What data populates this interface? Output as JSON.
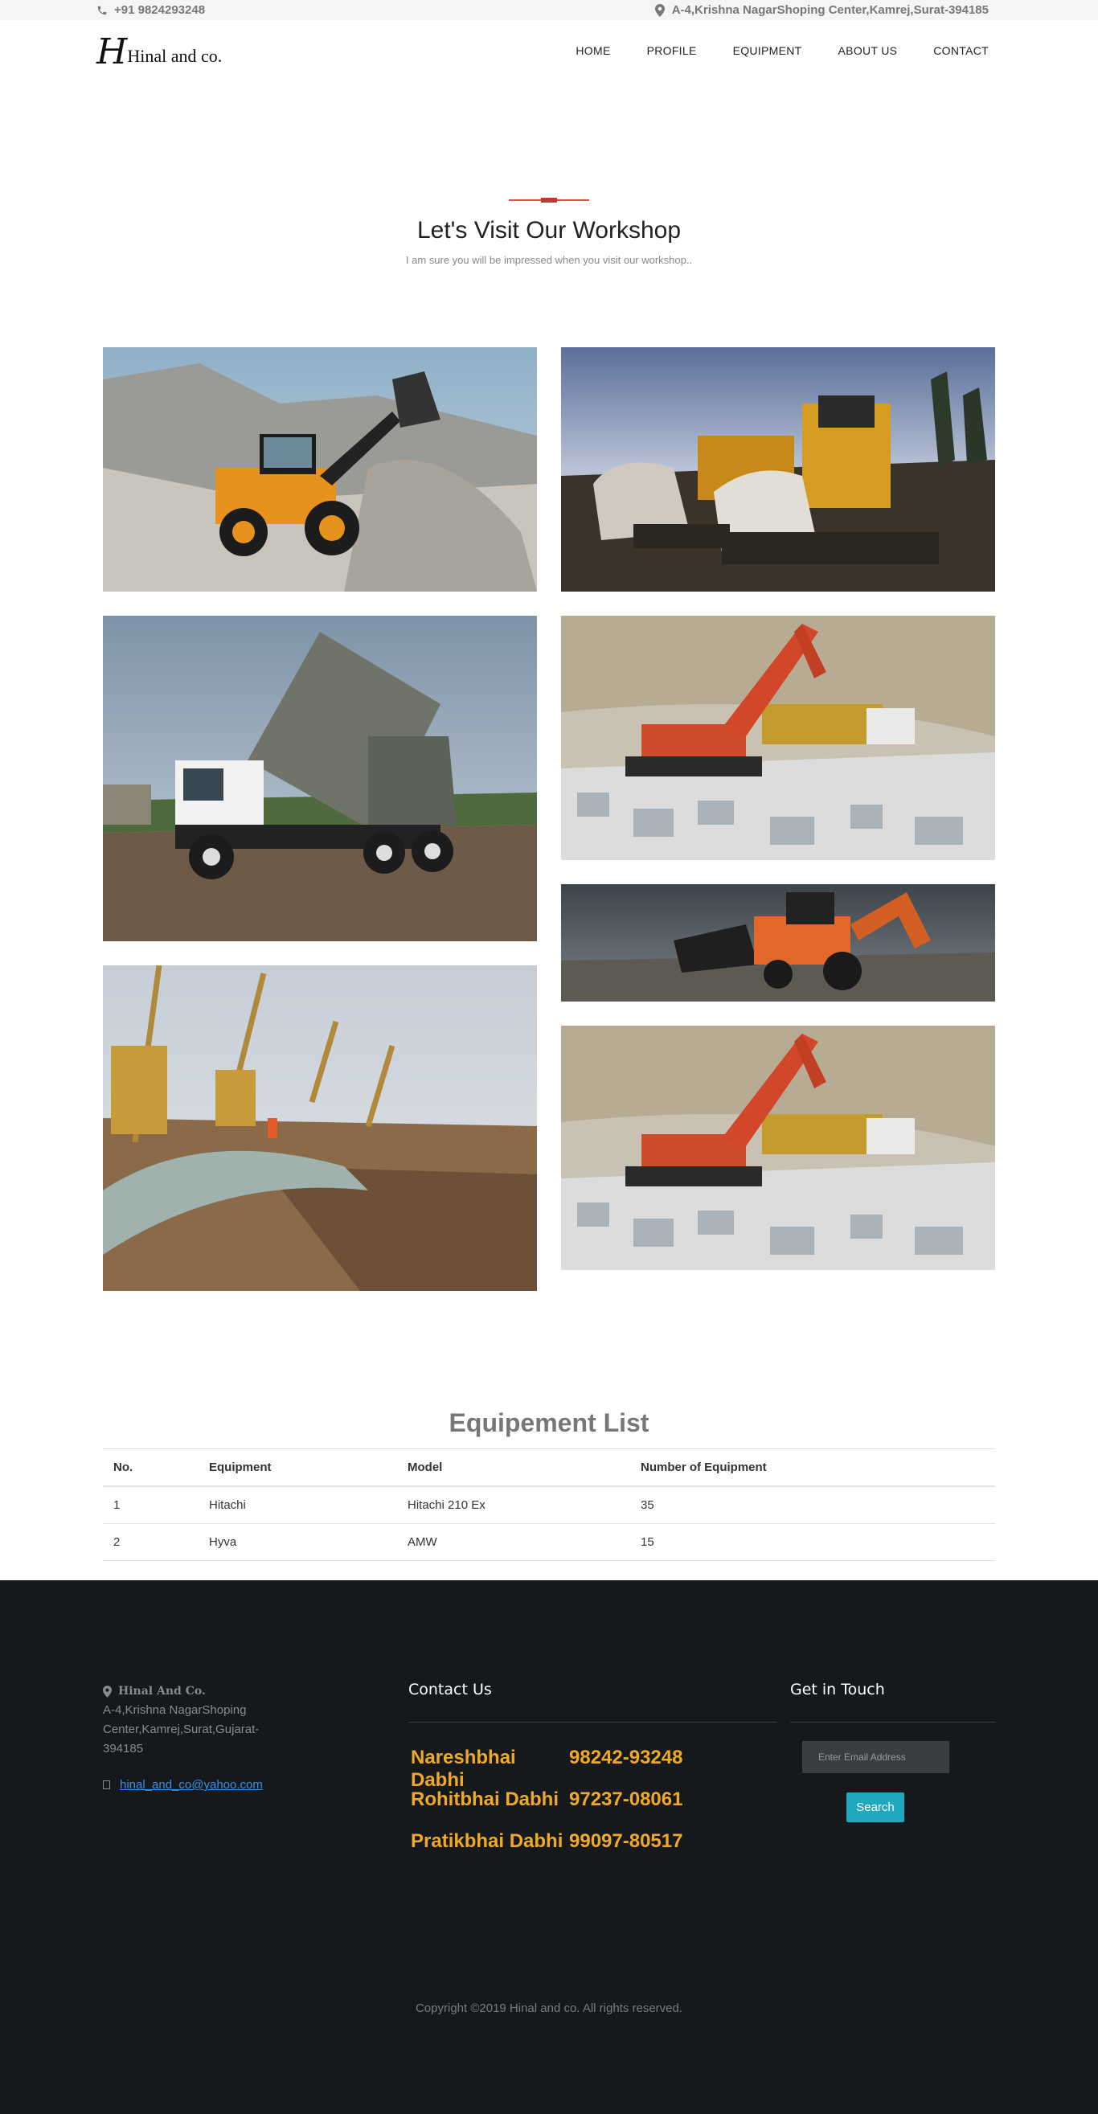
{
  "topbar": {
    "phone": "+91 9824293248",
    "address": "A-4,Krishna NagarShoping Center,Kamrej,Surat-394185"
  },
  "brand": {
    "mark": "H",
    "name": "Hinal and co."
  },
  "nav": [
    "HOME",
    "PROFILE",
    "EQUIPMENT",
    "ABOUT US",
    "CONTACT"
  ],
  "workshop": {
    "title": "Let's Visit Our Workshop",
    "subtitle": "I am sure you will be impressed when you visit our workshop.."
  },
  "gallery": [
    {
      "name": "wheel-loader-photo"
    },
    {
      "name": "bulldozers-photo"
    },
    {
      "name": "dump-truck-photo"
    },
    {
      "name": "excavator-quarry-photo"
    },
    {
      "name": "backhoe-loader-photo"
    },
    {
      "name": "pipeline-laying-photo"
    },
    {
      "name": "excavator-quarry-photo-2"
    }
  ],
  "equipment": {
    "title": "Equipement List",
    "headers": [
      "No.",
      "Equipment",
      "Model",
      "Number of Equipment"
    ],
    "rows": [
      [
        "1",
        "Hitachi",
        "Hitachi 210 Ex",
        "35"
      ],
      [
        "2",
        "Hyva",
        "AMW",
        "15"
      ]
    ]
  },
  "footer": {
    "company": "Hinal And Co.",
    "address": "A-4,Krishna NagarShoping Center,Kamrej,Surat,Gujarat-394185",
    "email": "hinal_and_co@yahoo.com",
    "contact_heading": "Contact Us",
    "contacts": [
      {
        "name": "Nareshbhai Dabhi",
        "phone": "98242-93248"
      },
      {
        "name": "Rohitbhai Dabhi",
        "phone": "97237-08061"
      },
      {
        "name": "Pratikbhai Dabhi",
        "phone": "99097-80517"
      }
    ],
    "touch_heading": "Get in Touch",
    "email_placeholder": "Enter Email Address",
    "search_label": "Search",
    "copyright": "Copyright ©2019 Hinal and co. All rights reserved."
  },
  "colors": {
    "accent_red": "#e84a3a",
    "footer_bg": "#16191c",
    "contact_orange": "#f0a925",
    "button_teal": "#1fa9c0",
    "link_blue": "#3b8fe8"
  }
}
